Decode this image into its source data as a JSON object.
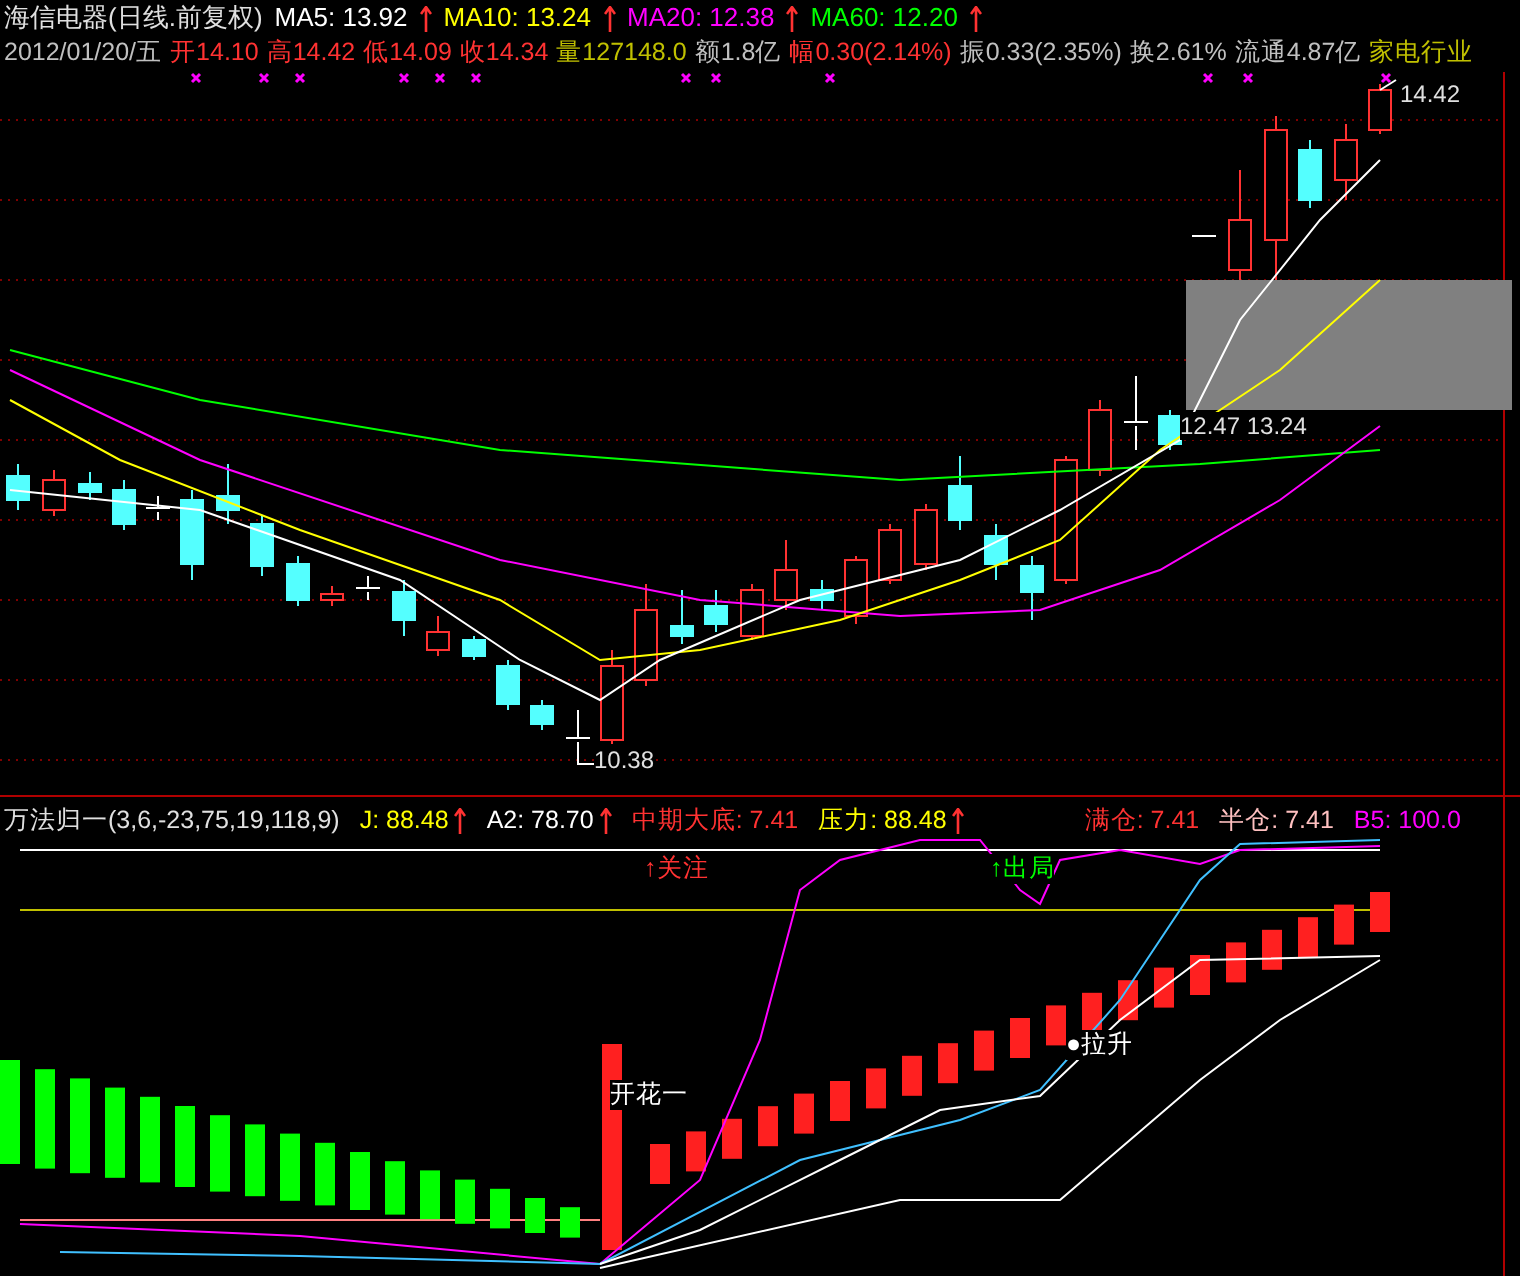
{
  "header": {
    "title": "海信电器(日线.前复权)",
    "moving_averages": [
      {
        "label": "MA5: 13.92",
        "color": "#ffffff"
      },
      {
        "label": "MA10: 13.24",
        "color": "#ffff00"
      },
      {
        "label": "MA20: 12.38",
        "color": "#ff00ff"
      },
      {
        "label": "MA60: 12.20",
        "color": "#00ff00"
      }
    ],
    "quote": [
      {
        "text": "2012/01/20/五",
        "color": "#c0c0c0"
      },
      {
        "text": "开14.10",
        "color": "#ff3232"
      },
      {
        "text": "高14.42",
        "color": "#ff3232"
      },
      {
        "text": "低14.09",
        "color": "#ff3232"
      },
      {
        "text": "收14.34",
        "color": "#ff3232"
      },
      {
        "text": "量127148.0",
        "color": "#c0c000"
      },
      {
        "text": "额1.8亿",
        "color": "#c0c0c0"
      },
      {
        "text": "幅0.30(2.14%)",
        "color": "#ff3232"
      },
      {
        "text": "振0.33(2.35%)",
        "color": "#c0c0c0"
      },
      {
        "text": "换2.61%",
        "color": "#c0c0c0"
      },
      {
        "text": "流通4.87亿",
        "color": "#c0c0c0"
      },
      {
        "text": "家电行业",
        "color": "#c0c000"
      }
    ]
  },
  "price_chart": {
    "labels": [
      {
        "text": "14.42"
      },
      {
        "text": "12.47 13.24"
      },
      {
        "text": "10.38"
      }
    ]
  },
  "indicator": {
    "title": "万法归一(3,6,-23,75,19,118,9)",
    "values": [
      {
        "label": "J: 88.48",
        "color": "#ffff00",
        "arrow": true
      },
      {
        "label": "A2: 78.70",
        "color": "#ffffff",
        "arrow": true
      },
      {
        "label": "中期大底: 7.41",
        "color": "#ff3232",
        "arrow": false
      },
      {
        "label": "压力: 88.48",
        "color": "#ffff00",
        "arrow": true
      },
      {
        "label": "满仓: 7.41",
        "color": "#ff3232",
        "arrow": false
      },
      {
        "label": "半仓: 7.41",
        "color": "#ffc0c0",
        "arrow": false
      },
      {
        "label": "B5: 100.0",
        "color": "#ff00ff",
        "arrow": false
      }
    ],
    "signals": [
      {
        "text": "↑关注",
        "color": "#ff3232"
      },
      {
        "text": "↑出局",
        "color": "#00ff00"
      },
      {
        "text": "●拉升",
        "color": "#ffffff"
      },
      {
        "text": "开花一",
        "color": "#ffffff"
      }
    ]
  }
}
